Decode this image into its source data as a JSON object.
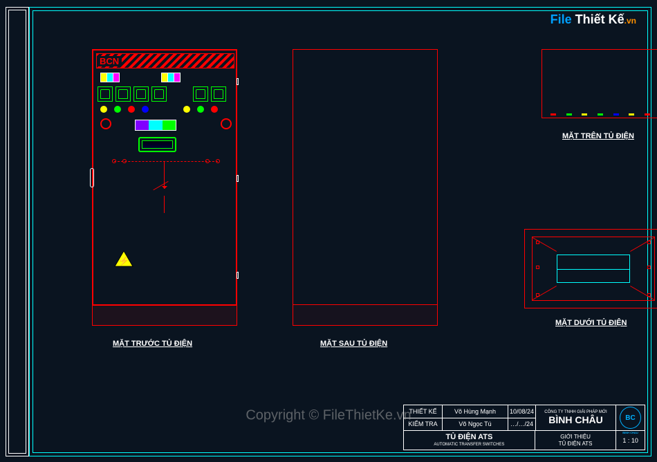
{
  "watermark": {
    "logo_text": "File Thiết Kế",
    "logo_suffix": ".vn",
    "center_text": "Copyright © FileThietKe.vn"
  },
  "header_logo": "BCN",
  "views": {
    "front": "MẶT TRƯỚC TỦ ĐIỆN",
    "back": "MẶT SAU TỦ ĐIỆN",
    "top": "MẶT TRÊN TỦ ĐIỆN",
    "bottom": "MẶT DƯỚI TỦ ĐIỆN"
  },
  "title_block": {
    "design_label": "THIẾT KẾ",
    "design_name": "Võ Hùng Mạnh",
    "design_date": "10/08/24",
    "check_label": "KIỂM TRA",
    "check_name": "Võ Ngọc Tú",
    "check_date": "…/…/24",
    "company_tag": "CÔNG TY TNHH GIẢI PHÁP MỚI",
    "company_name": "BÌNH CHÂU",
    "drawing_title": "TỦ ĐIỆN ATS",
    "drawing_sub": "AUTOMATIC TRANSFER SWITCHES",
    "sheet_desc_line1": "GIỚI THIỆU",
    "sheet_desc_line2": "TỦ ĐIỆN ATS",
    "scale": "1 : 10"
  },
  "colors": {
    "red": "#ff0000",
    "green": "#00ff00",
    "yellow": "#ffff00",
    "blue": "#0000ff",
    "cyan": "#00ffff"
  }
}
